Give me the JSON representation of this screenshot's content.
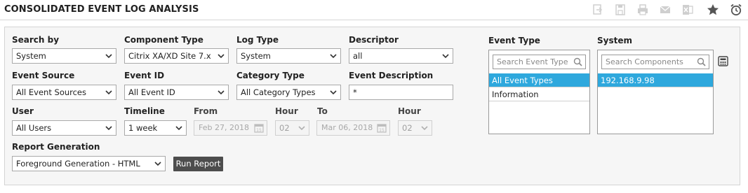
{
  "page": {
    "title": "CONSOLIDATED EVENT LOG ANALYSIS"
  },
  "toolbar": {
    "icons": [
      "export-icon",
      "save-icon",
      "print-icon",
      "mail-icon",
      "excel-icon",
      "favorite-star-icon",
      "schedule-alarm-icon"
    ]
  },
  "form": {
    "search_by": {
      "label": "Search by",
      "value": "System"
    },
    "component_type": {
      "label": "Component Type",
      "value": "Citrix XA/XD Site 7.x"
    },
    "log_type": {
      "label": "Log Type",
      "value": "System"
    },
    "descriptor": {
      "label": "Descriptor",
      "value": "all"
    },
    "event_source": {
      "label": "Event Source",
      "value": "All Event Sources"
    },
    "event_id": {
      "label": "Event ID",
      "value": "All Event ID"
    },
    "category_type": {
      "label": "Category Type",
      "value": "All Category Types"
    },
    "event_description": {
      "label": "Event Description",
      "value": "*"
    },
    "user": {
      "label": "User",
      "value": "All Users"
    },
    "timeline": {
      "label": "Timeline",
      "value": "1 week"
    },
    "from": {
      "label": "From",
      "value": "Feb 27, 2018"
    },
    "from_hour": {
      "label": "Hour",
      "value": "02"
    },
    "to": {
      "label": "To",
      "value": "Mar 06, 2018"
    },
    "to_hour": {
      "label": "Hour",
      "value": "02"
    },
    "report_generation": {
      "label": "Report Generation",
      "value": "Foreground Generation - HTML"
    },
    "run_report": {
      "label": "Run Report"
    }
  },
  "event_type": {
    "label": "Event Type",
    "search_placeholder": "Search Event Type",
    "items": [
      {
        "label": "All Event Types",
        "selected": true
      },
      {
        "label": "Information",
        "selected": false
      }
    ]
  },
  "system": {
    "label": "System",
    "search_placeholder": "Search Components",
    "items": [
      {
        "label": "192.168.9.98",
        "selected": true
      }
    ]
  },
  "colors": {
    "accent": "#2ea8dd",
    "button": "#4d4d4d"
  }
}
